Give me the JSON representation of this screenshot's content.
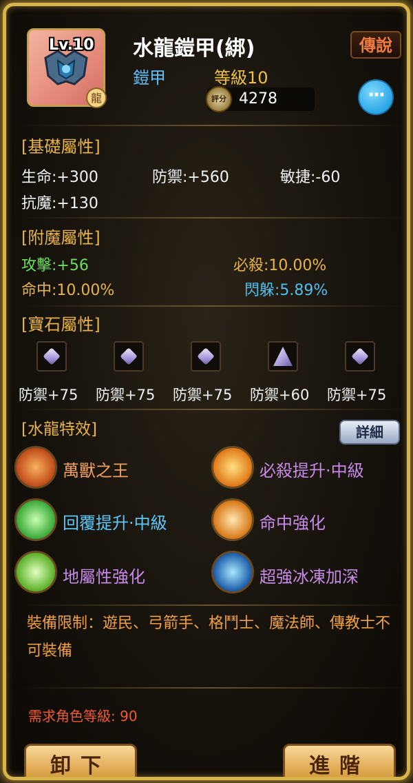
{
  "header": {
    "level_badge": "Lv.10",
    "dragon_badge": "龍",
    "item_name": "水龍鎧甲(綁)",
    "grade": "傳說",
    "item_type": "鎧甲",
    "item_level": "等級10",
    "score_icon": "評分",
    "score": "4278",
    "more_icon": "···"
  },
  "base_attributes": {
    "title": "[基礎屬性]",
    "hp": "生命:+300",
    "defense": "防禦:+560",
    "agility": "敏捷:-60",
    "magic_resist": "抗魔:+130"
  },
  "enchant_attributes": {
    "title": "[附魔屬性]",
    "attack": "攻擊:+56",
    "critical": "必殺:10.00%",
    "hit": "命中:10.00%",
    "dodge": "閃躲:5.89%"
  },
  "gem_attributes": {
    "title": "[寶石屬性]",
    "gems": [
      {
        "label": "防禦+75"
      },
      {
        "label": "防禦+75"
      },
      {
        "label": "防禦+75"
      },
      {
        "label": "防禦+60"
      },
      {
        "label": "防禦+75"
      }
    ]
  },
  "special_effects": {
    "title": "[水龍特效]",
    "detail_button": "詳細",
    "skills": [
      {
        "name": "萬獸之王",
        "icon": "beast-claw-icon"
      },
      {
        "name": "必殺提升·中級",
        "icon": "critical-up-icon"
      },
      {
        "name": "回覆提升·中級",
        "icon": "heal-up-icon"
      },
      {
        "name": "命中強化",
        "icon": "accuracy-icon"
      },
      {
        "name": "地屬性強化",
        "icon": "earth-element-icon"
      },
      {
        "name": "超強冰凍加深",
        "icon": "freeze-icon"
      }
    ]
  },
  "restriction": "裝備限制：遊民、弓箭手、格鬥士、魔法師、傳教士不可裝備",
  "requirement": "需求角色等級: 90",
  "buttons": {
    "unequip": "卸下",
    "advance": "進階"
  },
  "colors": {
    "frame_gold": "#d8b34a",
    "section_title": "#e8b448",
    "green_stat": "#6adf5a",
    "blue_stat": "#4ec0f0",
    "skill_violet": "#c78ae8",
    "restriction_orange": "#f0a040",
    "requirement_red": "#f05a30"
  }
}
